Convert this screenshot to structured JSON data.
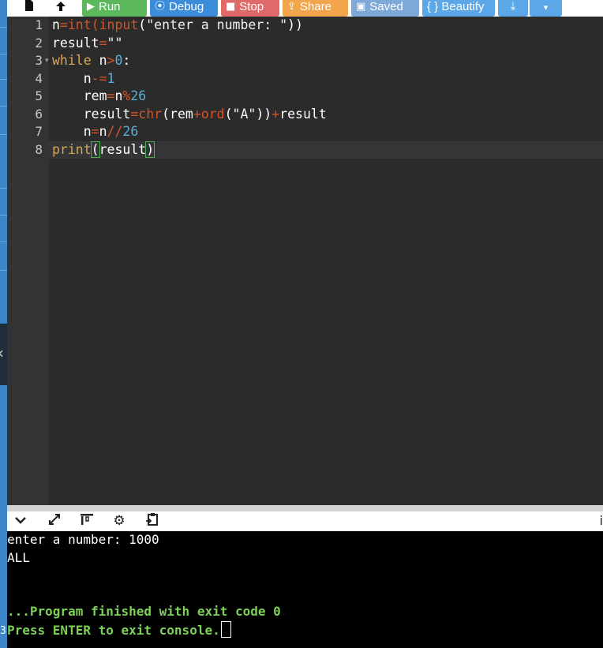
{
  "toolbar": {
    "buttons": [
      {
        "label": "",
        "icon": "file-icon",
        "color": "#ffffff"
      },
      {
        "label": "",
        "icon": "upload-icon",
        "color": "#ffffff"
      },
      {
        "label": "Run",
        "icon": "play-icon",
        "color": "#5cb85c"
      },
      {
        "label": "Debug",
        "icon": "debug-icon",
        "color": "#3b8dd9"
      },
      {
        "label": "Stop",
        "icon": "stop-icon",
        "color": "#e06a6a"
      },
      {
        "label": "Share",
        "icon": "share-icon",
        "color": "#f2a54a"
      },
      {
        "label": "Saved",
        "icon": "save-icon",
        "color": "#7da8d8"
      },
      {
        "label": "{ } Beautify",
        "icon": "",
        "color": "#5ba7e8"
      },
      {
        "label": "",
        "icon": "download-icon",
        "color": "#5ba7e8"
      },
      {
        "label": "",
        "icon": "caret-down-icon",
        "color": "#5ba7e8"
      }
    ]
  },
  "editor": {
    "line_numbers": [
      "1",
      "2",
      "3",
      "4",
      "5",
      "6",
      "7",
      "8"
    ],
    "fold_marker": "▾",
    "lines": [
      [
        {
          "t": "n",
          "c": ""
        },
        {
          "t": "=",
          "c": "op"
        },
        {
          "t": "int",
          "c": "fn"
        },
        {
          "t": "(",
          "c": "op"
        },
        {
          "t": "input",
          "c": "fn"
        },
        {
          "t": "(",
          "c": ""
        },
        {
          "t": "\"enter a number: \"",
          "c": "str"
        },
        {
          "t": "))",
          "c": ""
        }
      ],
      [
        {
          "t": "result",
          "c": ""
        },
        {
          "t": "=",
          "c": "op"
        },
        {
          "t": "\"\"",
          "c": "str"
        }
      ],
      [
        {
          "t": "while",
          "c": "kw"
        },
        {
          "t": " n",
          "c": ""
        },
        {
          "t": ">",
          "c": "op"
        },
        {
          "t": "0",
          "c": "num"
        },
        {
          "t": ":",
          "c": ""
        }
      ],
      [
        {
          "t": "    n",
          "c": ""
        },
        {
          "t": "-=",
          "c": "op"
        },
        {
          "t": "1",
          "c": "num"
        }
      ],
      [
        {
          "t": "    rem",
          "c": ""
        },
        {
          "t": "=",
          "c": "op"
        },
        {
          "t": "n",
          "c": ""
        },
        {
          "t": "%",
          "c": "op"
        },
        {
          "t": "26",
          "c": "num"
        }
      ],
      [
        {
          "t": "    result",
          "c": ""
        },
        {
          "t": "=",
          "c": "op"
        },
        {
          "t": "chr",
          "c": "fn"
        },
        {
          "t": "(rem",
          "c": ""
        },
        {
          "t": "+",
          "c": "op"
        },
        {
          "t": "ord",
          "c": "fn"
        },
        {
          "t": "(",
          "c": ""
        },
        {
          "t": "\"A\"",
          "c": "str"
        },
        {
          "t": "))",
          "c": ""
        },
        {
          "t": "+",
          "c": "op"
        },
        {
          "t": "result",
          "c": ""
        }
      ],
      [
        {
          "t": "    n",
          "c": ""
        },
        {
          "t": "=",
          "c": "op"
        },
        {
          "t": "n",
          "c": ""
        },
        {
          "t": "//",
          "c": "op"
        },
        {
          "t": "26",
          "c": "num"
        }
      ],
      [
        {
          "t": "print",
          "c": "kw"
        },
        {
          "t": "(",
          "c": "hl"
        },
        {
          "t": "result",
          "c": ""
        },
        {
          "t": ")",
          "c": "hl"
        }
      ]
    ]
  },
  "console_toolbar": {
    "icons": [
      "chevron-down-icon",
      "expand-icon",
      "layout-icon",
      "gear-icon",
      "clipboard-icon"
    ],
    "right_text": "i"
  },
  "console": {
    "lines": [
      {
        "text": "enter a number: 1000",
        "style": "white"
      },
      {
        "text": "ALL",
        "style": "white"
      },
      {
        "text": "",
        "style": "white"
      },
      {
        "text": "",
        "style": "white"
      },
      {
        "text": "...Program finished with exit code 0",
        "style": "green"
      },
      {
        "text": "Press ENTER to exit console.",
        "style": "green"
      }
    ]
  },
  "side_number": "3"
}
